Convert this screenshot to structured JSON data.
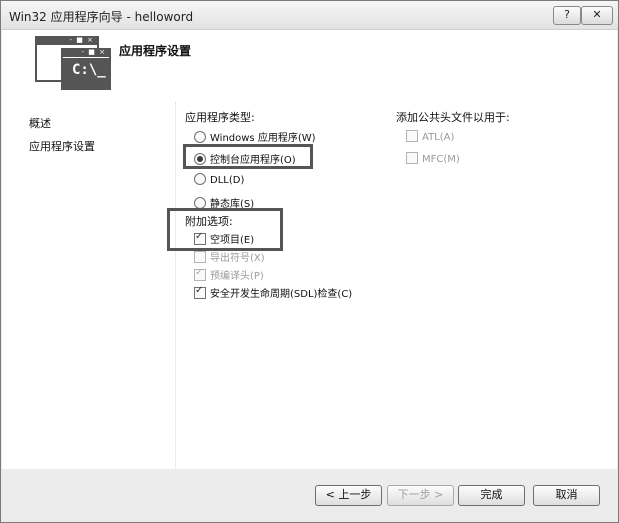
{
  "window": {
    "title": "Win32 应用程序向导 - helloword",
    "help_label": "?",
    "close_label": "✕"
  },
  "header": {
    "title": "应用程序设置",
    "icon_dots": "- ■ ×",
    "icon_prompt": "C:\\_"
  },
  "sidebar": {
    "items": [
      {
        "label": "概述"
      },
      {
        "label": "应用程序设置"
      }
    ]
  },
  "app_type": {
    "label": "应用程序类型:",
    "options": [
      {
        "label": "Windows 应用程序(W)",
        "selected": false
      },
      {
        "label": "控制台应用程序(O)",
        "selected": true
      },
      {
        "label": "DLL(D)",
        "selected": false
      },
      {
        "label": "静态库(S)",
        "selected": false
      }
    ]
  },
  "extra_options": {
    "label": "附加选项:",
    "options": [
      {
        "label": "空项目(E)",
        "checked": true,
        "enabled": true
      },
      {
        "label": "导出符号(X)",
        "checked": false,
        "enabled": false
      },
      {
        "label": "预编译头(P)",
        "checked": true,
        "enabled": false
      },
      {
        "label": "安全开发生命周期(SDL)检查(C)",
        "checked": true,
        "enabled": true
      }
    ]
  },
  "common_headers": {
    "label": "添加公共头文件以用于:",
    "options": [
      {
        "label": "ATL(A)",
        "checked": false,
        "enabled": false
      },
      {
        "label": "MFC(M)",
        "checked": false,
        "enabled": false
      }
    ]
  },
  "buttons": {
    "back": "< 上一步",
    "next": "下一步 >",
    "finish": "完成",
    "cancel": "取消"
  }
}
